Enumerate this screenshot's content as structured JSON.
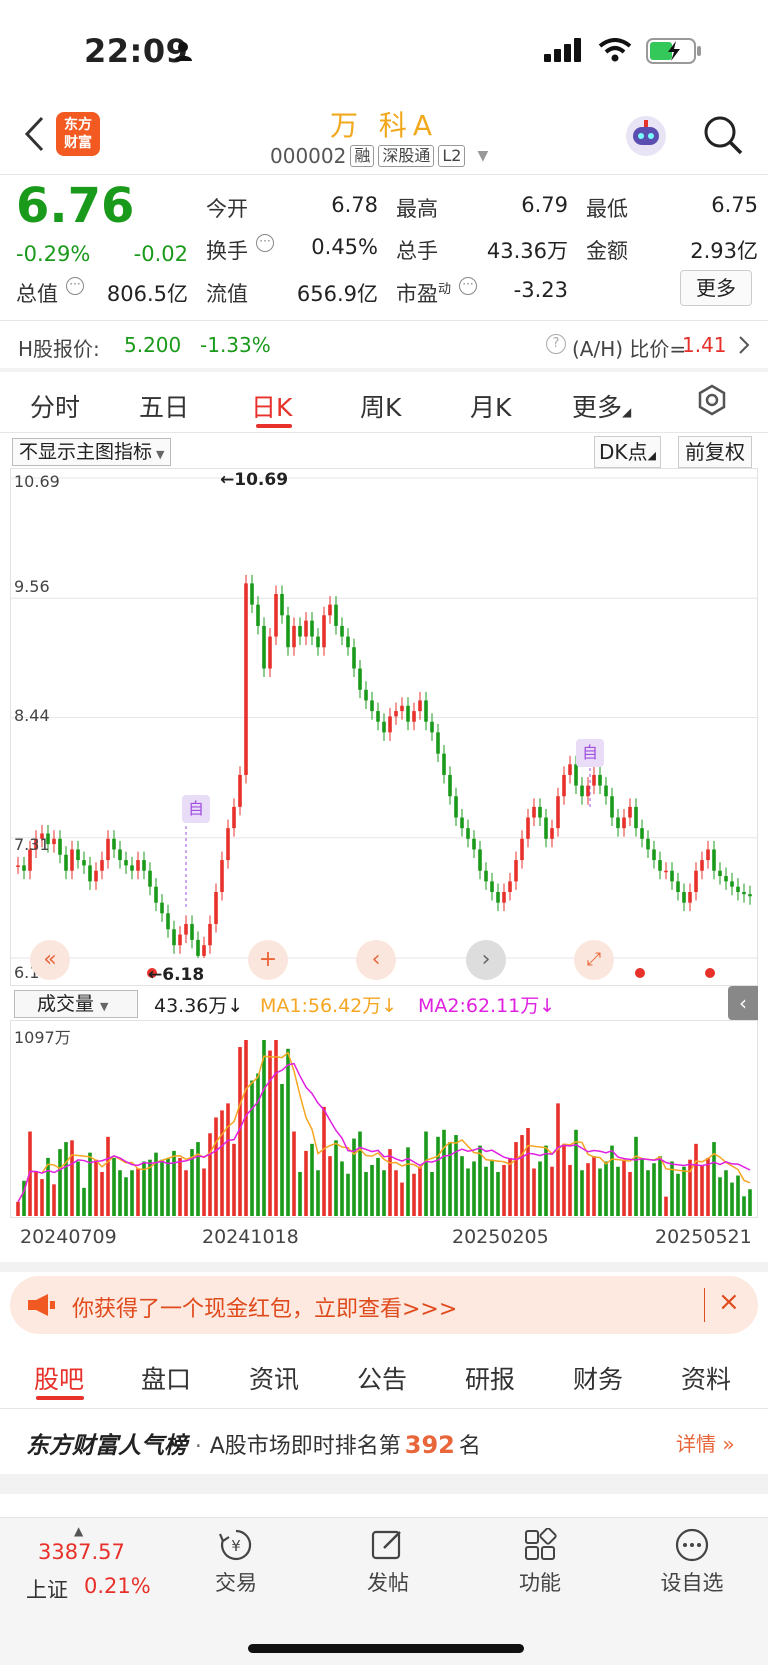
{
  "status": {
    "time": "22:09"
  },
  "header": {
    "logo": "东方财富",
    "title": "万 科A",
    "code": "000002",
    "tags": [
      "融",
      "深股通",
      "L2"
    ]
  },
  "quote": {
    "price": "6.76",
    "change_pct": "-0.29%",
    "change": "-0.02",
    "open_label": "今开",
    "open": "6.78",
    "high_label": "最高",
    "high": "6.79",
    "low_label": "最低",
    "low": "6.75",
    "turnover_label": "换手",
    "turnover": "0.45%",
    "volume_label": "总手",
    "volume": "43.36万",
    "amount_label": "金额",
    "amount": "2.93亿",
    "mktcap_label": "总值",
    "mktcap": "806.5亿",
    "float_label": "流值",
    "float": "656.9亿",
    "pe_label": "市盈",
    "pe_sup": "动",
    "pe": "-3.23",
    "more": "更多"
  },
  "hshare": {
    "label": "H股报价:",
    "price": "5.200",
    "change": "-1.33%",
    "ah_label": "(A/H) 比价=",
    "ah_value": "1.41"
  },
  "tabs": [
    "分时",
    "五日",
    "日K",
    "周K",
    "月K",
    "更多"
  ],
  "active_tab": 2,
  "chart_bar": {
    "indicator": "不显示主图指标",
    "dk": "DK点",
    "adjust": "前复权"
  },
  "chart_data": {
    "type": "candlestick",
    "y_ticks": [
      "10.69",
      "9.56",
      "8.44",
      "7.31",
      "6.18"
    ],
    "ylim": [
      6.18,
      10.69
    ],
    "max_label": "←10.69",
    "min_label": "←6.18",
    "marker_label": "自",
    "dates": [
      "20240709",
      "20241018",
      "20250205",
      "20250521"
    ],
    "close": [
      7.05,
      7.0,
      7.2,
      7.3,
      7.35,
      7.25,
      7.3,
      7.15,
      7.0,
      7.2,
      7.1,
      7.05,
      6.9,
      7.0,
      7.1,
      7.3,
      7.2,
      7.1,
      7.05,
      7.0,
      7.1,
      7.0,
      6.85,
      6.7,
      6.6,
      6.45,
      6.3,
      6.4,
      6.5,
      6.35,
      6.2,
      6.3,
      6.5,
      6.8,
      7.1,
      7.4,
      7.6,
      7.9,
      9.7,
      9.5,
      9.3,
      8.9,
      9.2,
      9.6,
      9.4,
      9.1,
      9.3,
      9.2,
      9.35,
      9.2,
      9.1,
      9.4,
      9.5,
      9.3,
      9.2,
      9.1,
      8.9,
      8.7,
      8.6,
      8.5,
      8.4,
      8.3,
      8.45,
      8.5,
      8.55,
      8.4,
      8.5,
      8.6,
      8.4,
      8.3,
      8.1,
      7.9,
      7.7,
      7.5,
      7.4,
      7.3,
      7.2,
      7.0,
      6.9,
      6.8,
      6.7,
      6.8,
      6.9,
      7.1,
      7.3,
      7.5,
      7.6,
      7.5,
      7.3,
      7.4,
      7.7,
      7.9,
      8.0,
      7.8,
      7.7,
      7.8,
      7.9,
      7.8,
      7.7,
      7.5,
      7.4,
      7.5,
      7.6,
      7.4,
      7.3,
      7.2,
      7.1,
      7.0,
      7.0,
      6.9,
      6.8,
      6.7,
      6.8,
      7.0,
      7.1,
      7.2,
      7.0,
      6.95,
      6.9,
      6.85,
      6.8,
      6.78,
      6.76
    ],
    "volume_series": [
      "成交量",
      "MA1",
      "MA2"
    ],
    "volume_max_label": "1097万",
    "volume_value": "43.36万",
    "ma1": "MA1:56.42万",
    "ma2": "MA2:62.11万",
    "colors": {
      "up": "#e8312b",
      "down": "#1a9a1a",
      "ma1": "#f5a623",
      "ma2": "#e020e0"
    }
  },
  "banner": {
    "text": "你获得了一个现金红包，立即查看>>>"
  },
  "bottom_tabs": [
    "股吧",
    "盘口",
    "资讯",
    "公告",
    "研报",
    "财务",
    "资料"
  ],
  "rank": {
    "brand": "东方财富人气榜",
    "dot": "·",
    "text": "A股市场即时排名第",
    "number": "392",
    "unit": "名",
    "detail": "详情"
  },
  "footer": {
    "index_value": "3387.57",
    "index_name": "上证",
    "index_change": "0.21%",
    "items": [
      "交易",
      "发帖",
      "功能",
      "设自选"
    ]
  }
}
